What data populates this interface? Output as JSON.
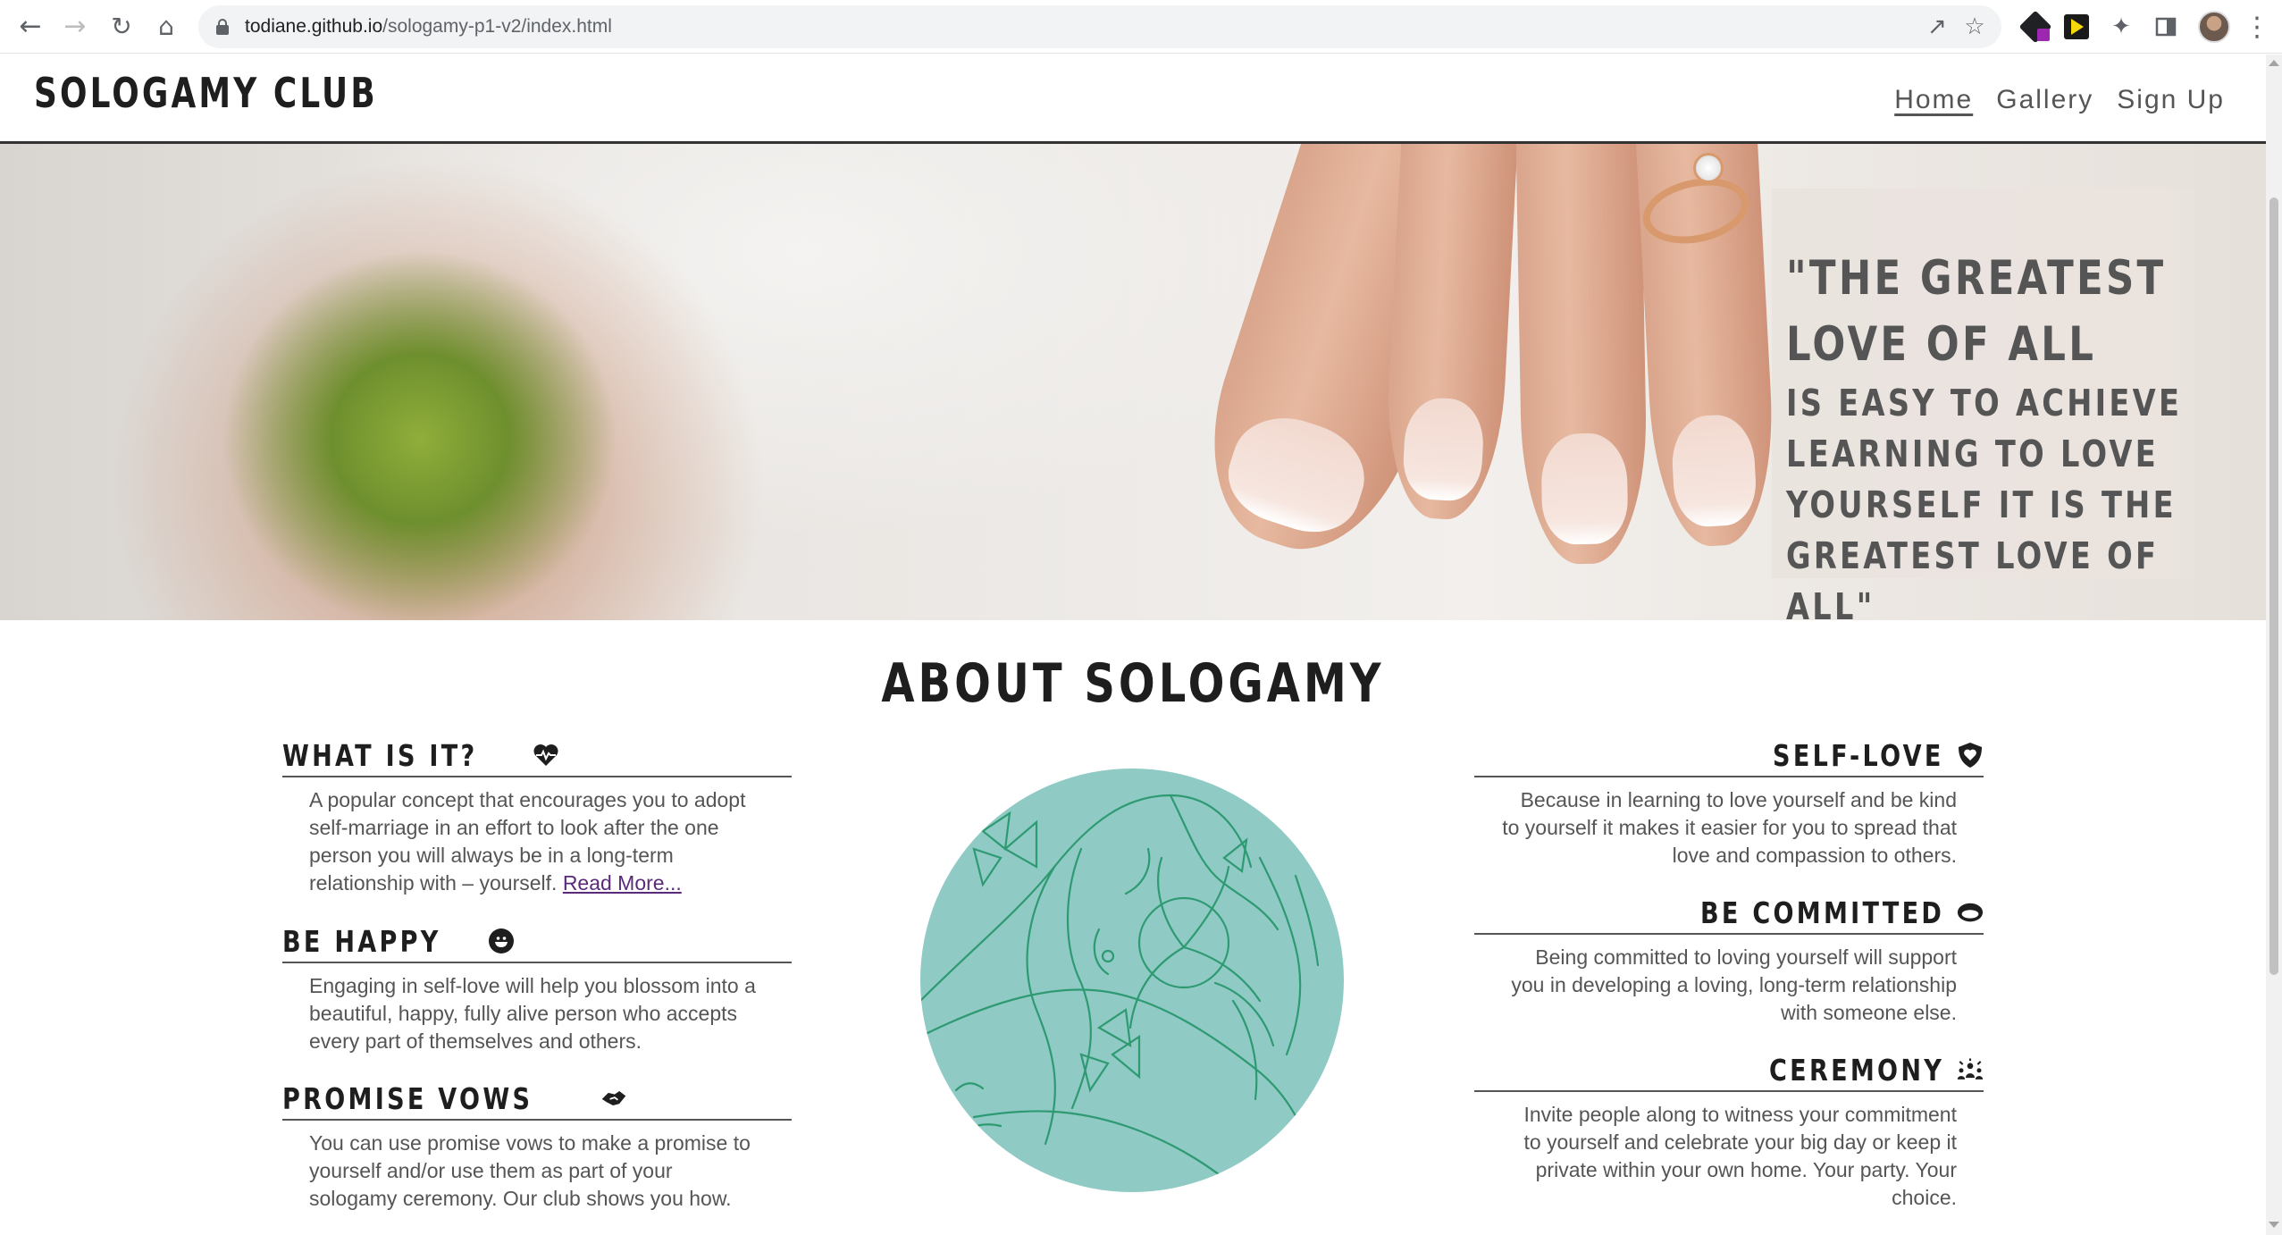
{
  "browser": {
    "url_host": "todiane.github.io",
    "url_path": "/sologamy-p1-v2/index.html"
  },
  "header": {
    "logo": "SOLOGAMY CLUB",
    "nav": [
      {
        "label": "Home",
        "active": true
      },
      {
        "label": "Gallery",
        "active": false
      },
      {
        "label": "Sign Up",
        "active": false
      }
    ]
  },
  "hero": {
    "quote_line1": "\"THE GREATEST",
    "quote_line2": "LOVE OF ALL",
    "quote_line3": "IS EASY TO ACHIEVE",
    "quote_line4": "LEARNING TO LOVE",
    "quote_line5": "YOURSELF IT IS THE",
    "quote_line6": "GREATEST LOVE OF ALL\""
  },
  "about": {
    "title": "ABOUT SOLOGAMY",
    "left": [
      {
        "title": "WHAT IS IT?",
        "icon": "heartbeat-icon",
        "text": "A popular concept that encourages you to adopt self-marriage in an effort to look after the one person you will always be in a long-term relationship with – yourself.",
        "link": "Read More..."
      },
      {
        "title": "BE HAPPY",
        "icon": "grin-icon",
        "text": "Engaging in self-love will help you blossom into a beautiful, happy, fully alive person who accepts every part of themselves and others."
      },
      {
        "title": "PROMISE VOWS",
        "icon": "handshake-icon",
        "text": "You can use promise vows to make a promise to yourself and/or use them as part of your sologamy ceremony. Our club shows you how."
      }
    ],
    "right": [
      {
        "title": "SELF-LOVE",
        "icon": "shield-heart-icon",
        "text": "Because in learning to love yourself and be kind to yourself it makes it easier for you to spread that love and compassion to others."
      },
      {
        "title": "BE COMMITTED",
        "icon": "ring-icon",
        "text": "Being committed to loving yourself will support you in developing a loving, long-term relationship with someone else."
      },
      {
        "title": "CEREMONY",
        "icon": "people-celebrate-icon",
        "text": "Invite people along to witness your commitment to yourself and celebrate your big day or keep it private within your own home. Your party. Your choice."
      }
    ]
  },
  "colors": {
    "accent_teal": "#8fcac4",
    "line_art_green": "#2e9a72",
    "heading_dark": "#1e1e1e",
    "body_text": "#555555",
    "link_purple": "#5a2b7a"
  }
}
